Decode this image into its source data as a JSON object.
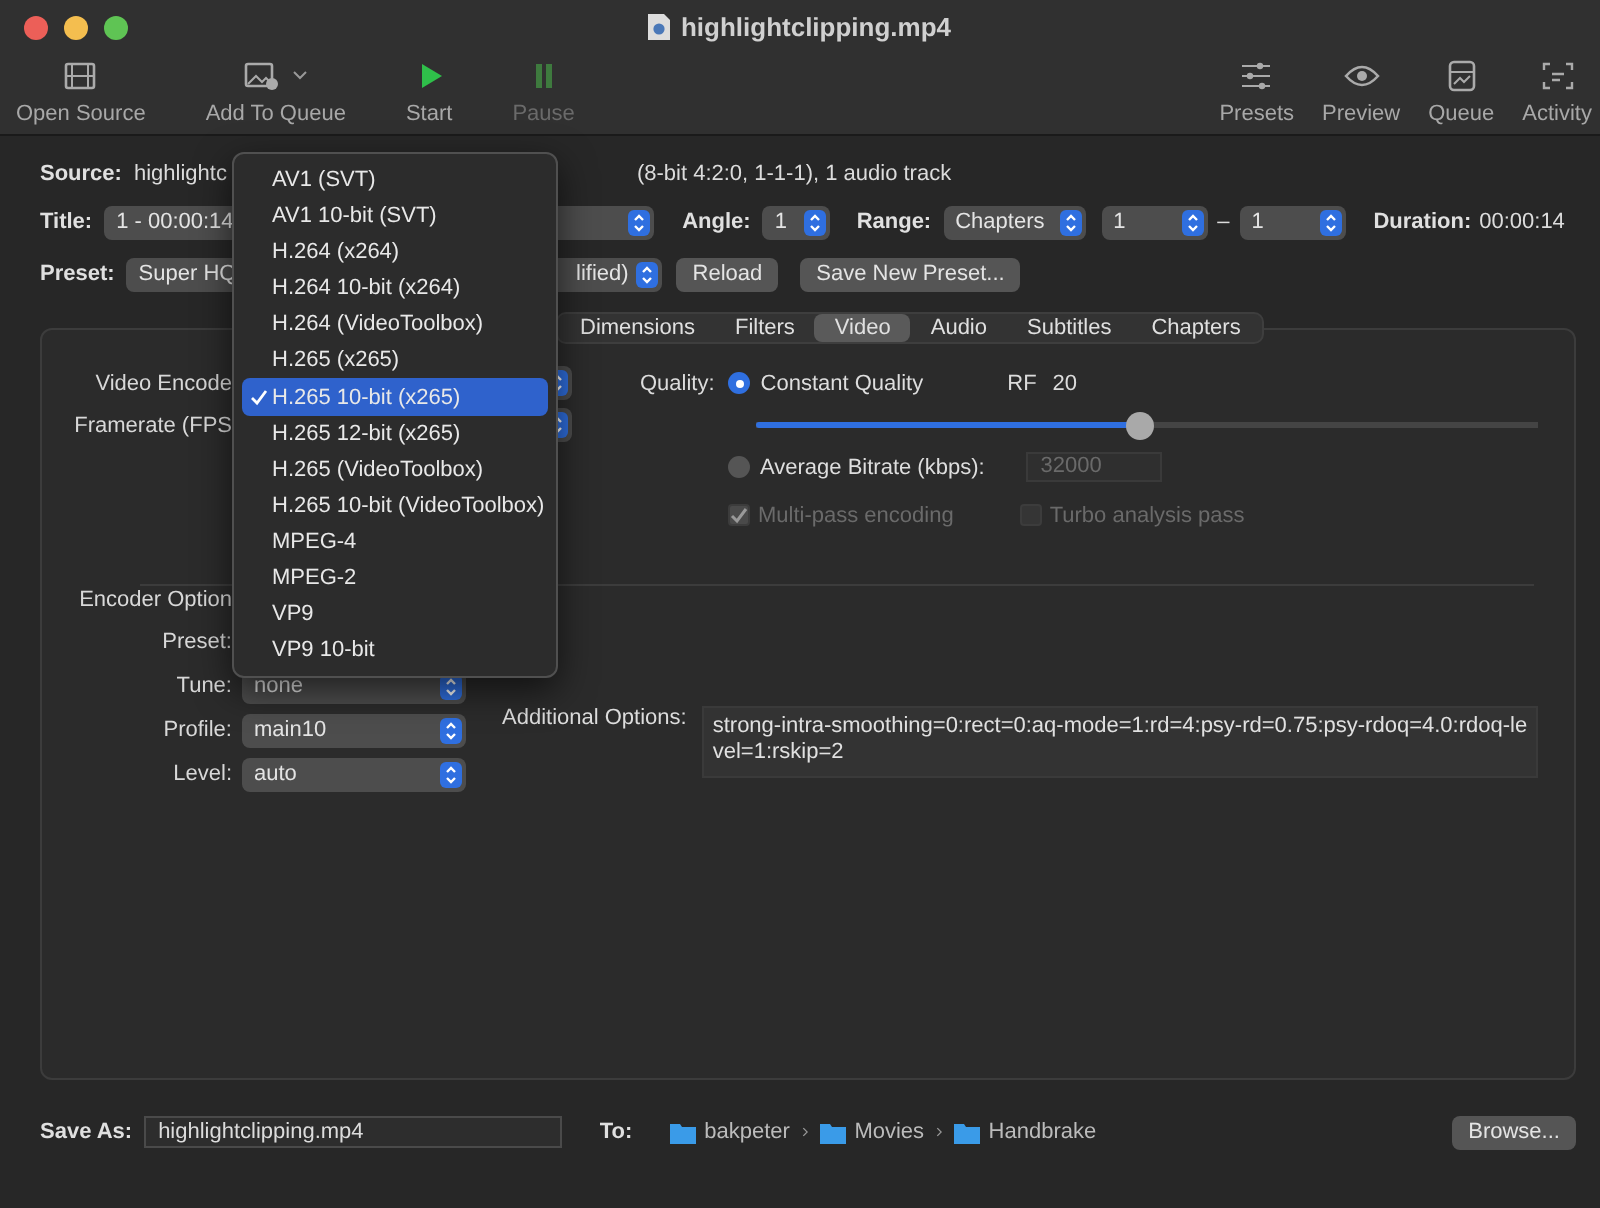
{
  "window": {
    "title": "highlightclipping.mp4"
  },
  "toolbar": {
    "left": [
      {
        "label": "Open Source",
        "kind": "film",
        "disabled": false,
        "menu": false
      },
      {
        "label": "Add To Queue",
        "kind": "photo",
        "disabled": false,
        "menu": true
      },
      {
        "label": "Start",
        "kind": "play",
        "disabled": false,
        "menu": false
      },
      {
        "label": "Pause",
        "kind": "pause",
        "disabled": true,
        "menu": false
      }
    ],
    "right": [
      {
        "label": "Presets",
        "kind": "sliders",
        "disabled": false
      },
      {
        "label": "Preview",
        "kind": "eye",
        "disabled": false
      },
      {
        "label": "Queue",
        "kind": "tray",
        "disabled": false
      },
      {
        "label": "Activity",
        "kind": "activity",
        "disabled": false
      }
    ]
  },
  "source": {
    "label": "Source:",
    "value_visible_start": "highlightc",
    "value_visible_end": "(8-bit 4:2:0, 1-1-1), 1 audio track"
  },
  "title_row": {
    "label": "Title:",
    "value": "1 - 00:00:14",
    "angle_label": "Angle:",
    "angle": "1",
    "range_label": "Range:",
    "range": "Chapters",
    "range_from": "1",
    "range_sep": "–",
    "range_to": "1",
    "duration_label": "Duration:",
    "duration": "00:00:14"
  },
  "preset_row": {
    "label": "Preset:",
    "value_visible_start": "Super HQ",
    "value_visible_end": "lified)",
    "buttons": [
      "Reload",
      "Save New Preset..."
    ]
  },
  "tabs": [
    {
      "label": "Dimensions",
      "selected": false
    },
    {
      "label": "Filters",
      "selected": false
    },
    {
      "label": "Video",
      "selected": true
    },
    {
      "label": "Audio",
      "selected": false
    },
    {
      "label": "Subtitles",
      "selected": false
    },
    {
      "label": "Chapters",
      "selected": false
    }
  ],
  "video": {
    "encoder_label": "Video Encode",
    "framerate_label": "Framerate (FPS",
    "quality_label": "Quality:",
    "constant_quality": {
      "label": "Constant Quality",
      "selected": true
    },
    "rf_label": "RF",
    "rf": "20",
    "rf_slider": {
      "level": 0.49
    },
    "average_bitrate": {
      "label": "Average Bitrate (kbps):",
      "selected": false,
      "value": "32000",
      "disabled": true
    },
    "multipass": {
      "label": "Multi-pass encoding",
      "checked": true,
      "disabled": true
    },
    "turbo": {
      "label": "Turbo analysis pass",
      "checked": false,
      "disabled": true
    },
    "encoder_options_label": "Encoder Option",
    "options": [
      {
        "label": "Preset:"
      },
      {
        "label": "Tune:",
        "value": "none"
      },
      {
        "label": "Profile:",
        "value": "main10"
      },
      {
        "label": "Level:",
        "value": "auto"
      }
    ],
    "additional_label": "Additional Options:",
    "additional": "strong-intra-smoothing=0:rect=0:aq-mode=1:rd=4:psy-rd=0.75:psy-rdoq=4.0:rdoq-level=1:rskip=2"
  },
  "save": {
    "label": "Save As:",
    "value": "highlightclipping.mp4",
    "to_label": "To:",
    "path": [
      "bakpeter",
      "Movies",
      "Handbrake"
    ],
    "browse": "Browse..."
  },
  "encoder_menu": [
    {
      "label": "AV1 (SVT)",
      "selected": false
    },
    {
      "label": "AV1 10-bit (SVT)",
      "selected": false
    },
    {
      "label": "H.264 (x264)",
      "selected": false
    },
    {
      "label": "H.264 10-bit (x264)",
      "selected": false
    },
    {
      "label": "H.264 (VideoToolbox)",
      "selected": false
    },
    {
      "label": "H.265 (x265)",
      "selected": false
    },
    {
      "label": "H.265 10-bit (x265)",
      "selected": true
    },
    {
      "label": "H.265 12-bit (x265)",
      "selected": false
    },
    {
      "label": "H.265 (VideoToolbox)",
      "selected": false
    },
    {
      "label": "H.265 10-bit (VideoToolbox)",
      "selected": false
    },
    {
      "label": "MPEG-4",
      "selected": false
    },
    {
      "label": "MPEG-2",
      "selected": false
    },
    {
      "label": "VP9",
      "selected": false
    },
    {
      "label": "VP9 10-bit",
      "selected": false
    }
  ]
}
